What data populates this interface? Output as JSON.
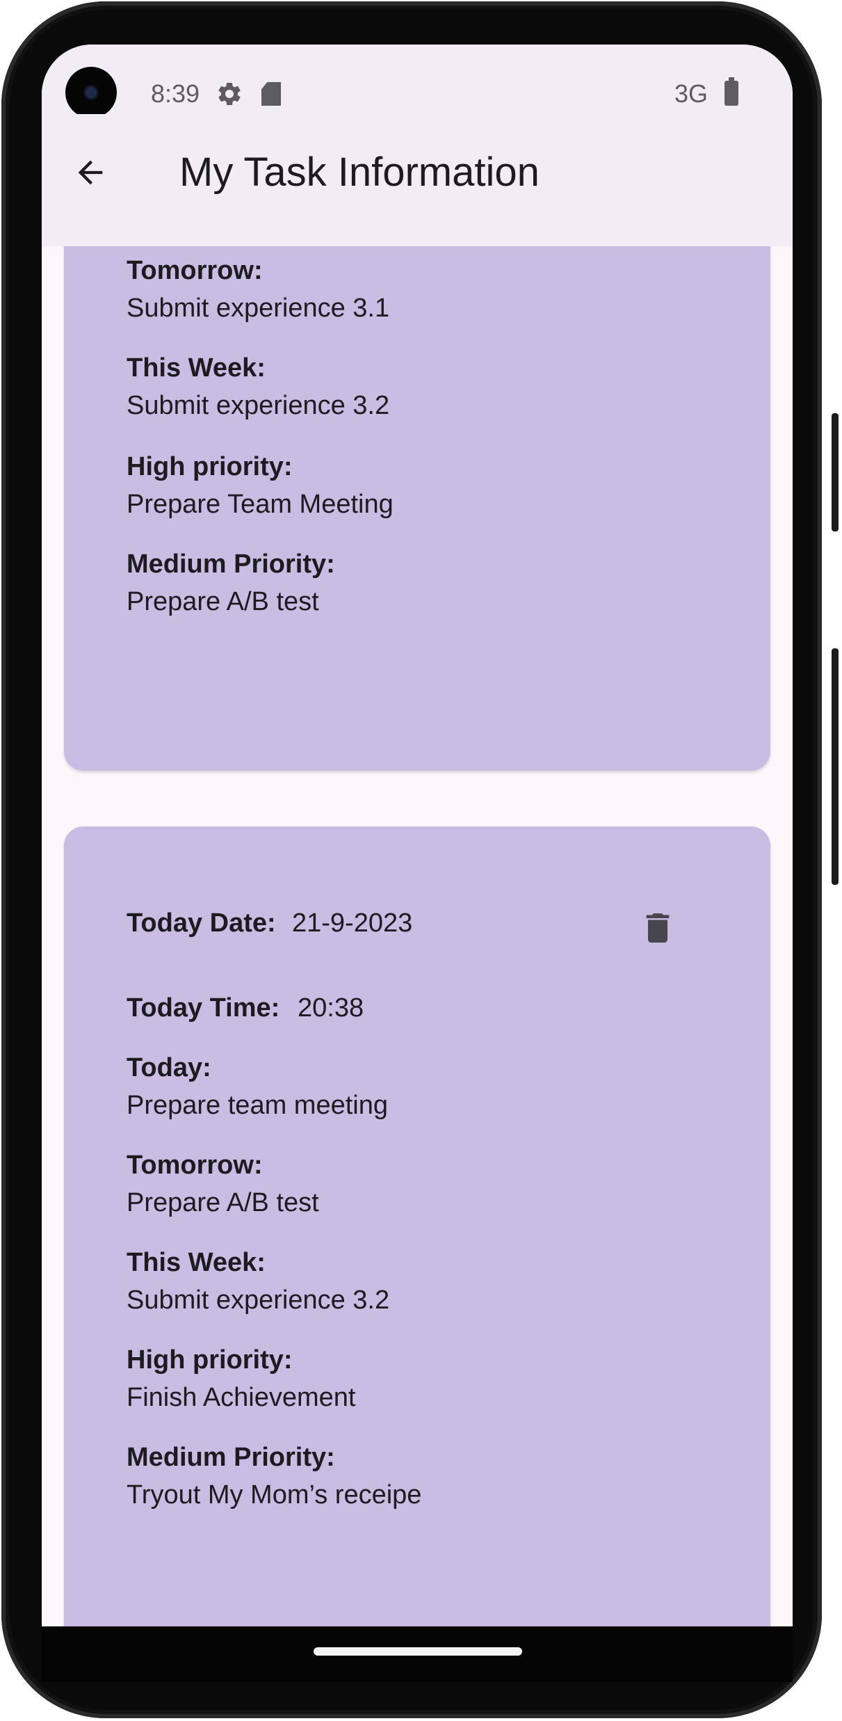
{
  "status_bar": {
    "time": "8:39",
    "network": "3G",
    "icons": [
      "settings-icon",
      "sd-card-icon",
      "battery-icon"
    ]
  },
  "app_bar": {
    "title": "My Task Information",
    "back_icon": "arrow-back-icon"
  },
  "colors": {
    "card_bg": "#cabde3",
    "app_bar_bg": "#f2edf4",
    "page_bg": "#fdf7fb",
    "text": "#1d1b20"
  },
  "tasks": [
    {
      "tomorrow_label": "Tomorrow:",
      "tomorrow": "Submit experience 3.1",
      "this_week_label": "This Week:",
      "this_week": "Submit experience 3.2",
      "high_label": "High priority:",
      "high": "Prepare Team Meeting",
      "medium_label": "Medium Priority:",
      "medium": "Prepare A/B test"
    },
    {
      "date_label": "Today Date:",
      "date": "21-9-2023",
      "time_label": "Today Time:",
      "time": "20:38",
      "today_label": "Today:",
      "today": "Prepare team meeting",
      "tomorrow_label": "Tomorrow:",
      "tomorrow": "Prepare A/B test",
      "this_week_label": "This Week:",
      "this_week": "Submit experience 3.2",
      "high_label": "High priority:",
      "high": "Finish Achievement",
      "medium_label": "Medium Priority:",
      "medium": "Tryout My Mom’s receipe",
      "delete_icon": "trash-icon"
    }
  ]
}
